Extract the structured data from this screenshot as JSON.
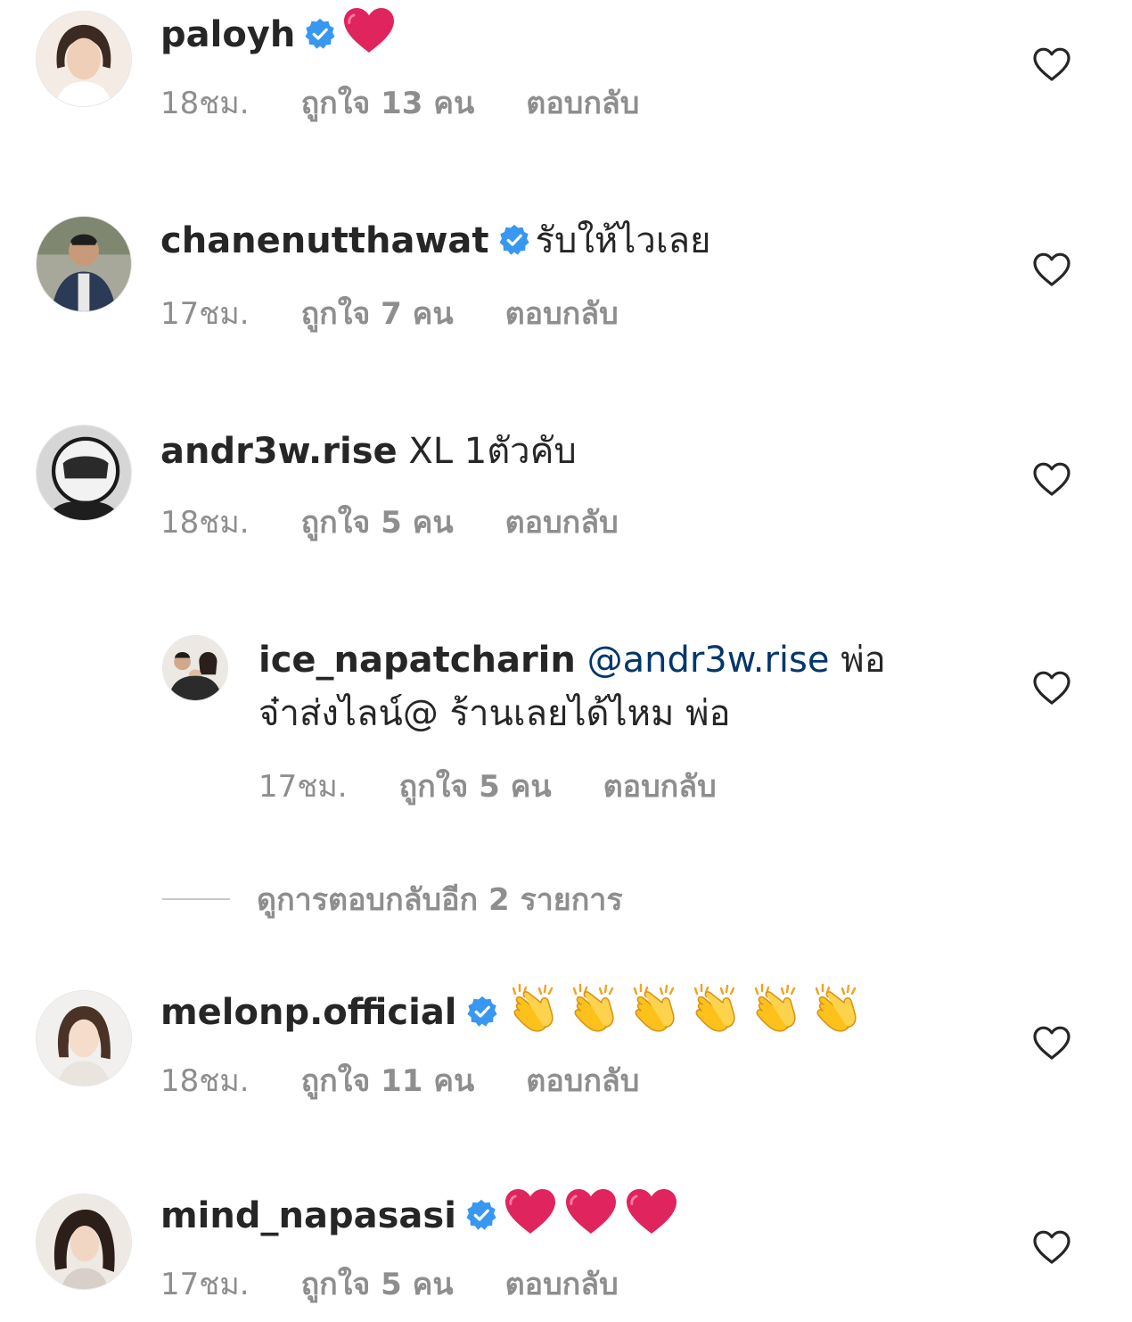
{
  "comments": [
    {
      "username": "paloyh",
      "verified": true,
      "text": "",
      "emoji": [
        "red-heart"
      ],
      "time": "18ชม.",
      "likes": "ถูกใจ 13 คน",
      "reply": "ตอบกลับ"
    },
    {
      "username": "chanenutthawat",
      "verified": true,
      "text": "รับให้ไวเลย",
      "emoji": [],
      "time": "17ชม.",
      "likes": "ถูกใจ 7 คน",
      "reply": "ตอบกลับ"
    },
    {
      "username": "andr3w.rise",
      "verified": false,
      "text": "XL 1ตัวคับ",
      "emoji": [],
      "time": "18ชม.",
      "likes": "ถูกใจ 5 คน",
      "reply": "ตอบกลับ"
    },
    {
      "username": "ice_napatcharin",
      "verified": false,
      "mention": "@andr3w.rise",
      "text_after_mention": "พ่อ",
      "text_line2": "จ๋าส่งไลน์@ ร้านเลยได้ไหม พ่อ",
      "time": "17ชม.",
      "likes": "ถูกใจ 5 คน",
      "reply": "ตอบกลับ"
    },
    {
      "username": "melonp.official",
      "verified": true,
      "text": "",
      "emoji": [
        "clapping-hands",
        "clapping-hands",
        "clapping-hands",
        "clapping-hands",
        "clapping-hands",
        "clapping-hands"
      ],
      "time": "18ชม.",
      "likes": "ถูกใจ 11 คน",
      "reply": "ตอบกลับ"
    },
    {
      "username": "mind_napasasi",
      "verified": true,
      "text": "",
      "emoji": [
        "red-heart",
        "red-heart",
        "red-heart"
      ],
      "time": "17ชม.",
      "likes": "ถูกใจ 5 คน",
      "reply": "ตอบกลับ"
    }
  ],
  "view_replies_label": "ดูการตอบกลับอีก 2 รายการ",
  "colors": {
    "text": "#262626",
    "meta": "#8e8e8e",
    "mention": "#00376b",
    "verified_badge": "#3897f0",
    "heart_emoji": "#e0245e"
  }
}
